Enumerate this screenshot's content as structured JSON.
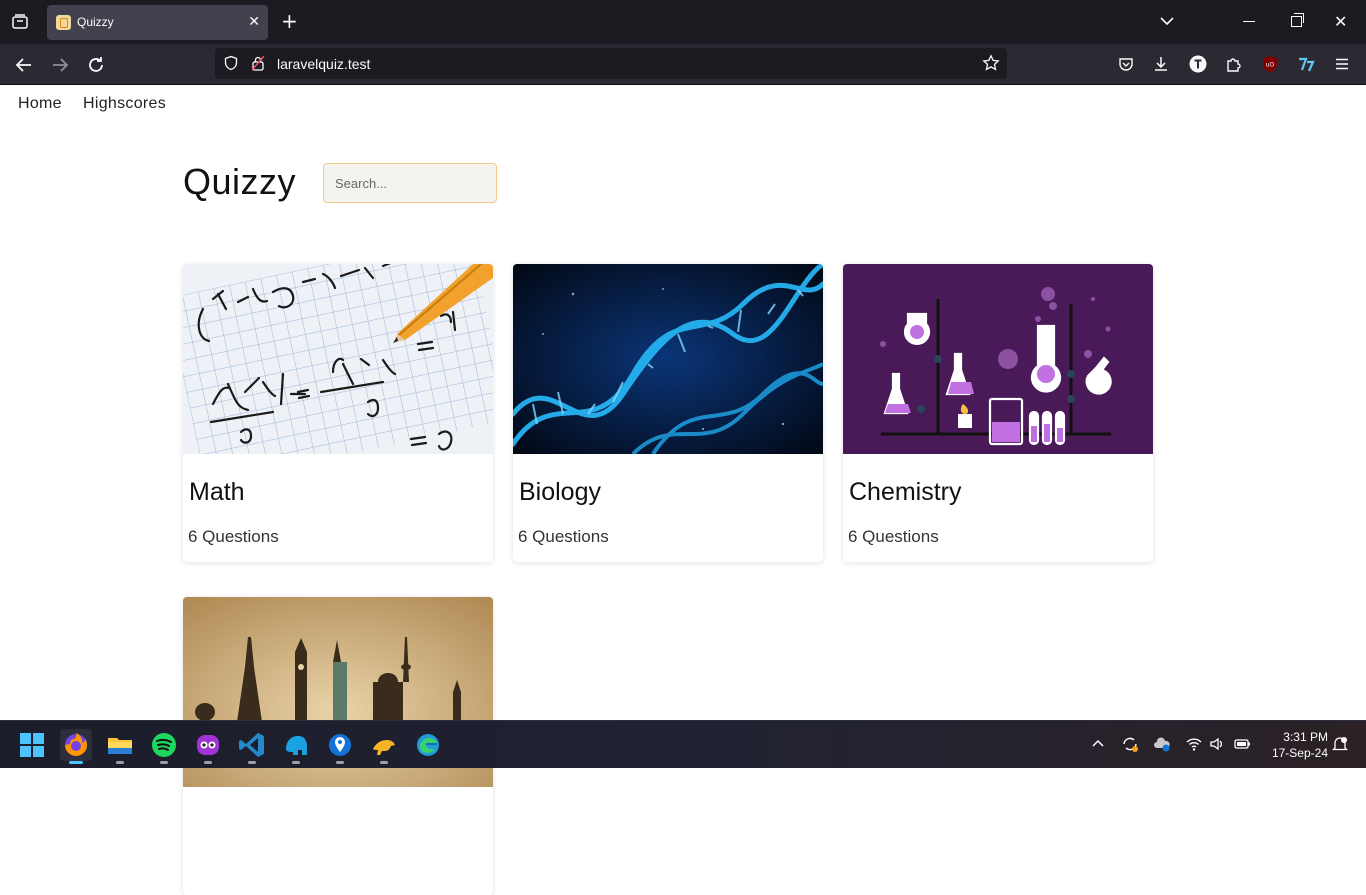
{
  "browser": {
    "tab_title": "Quizzy",
    "url": "laravelquiz.test"
  },
  "site": {
    "nav": [
      {
        "label": "Home"
      },
      {
        "label": "Highscores"
      }
    ],
    "title": "Quizzy",
    "search": {
      "placeholder": "Search...",
      "value": ""
    }
  },
  "quizzes": [
    {
      "title": "Math",
      "questions": "6 Questions",
      "image": "math-notebook-pencil"
    },
    {
      "title": "Biology",
      "questions": "6 Questions",
      "image": "dna-helix"
    },
    {
      "title": "Chemistry",
      "questions": "6 Questions",
      "image": "chemistry-lab-flasks"
    },
    {
      "title": "",
      "questions": "",
      "image": "world-landmarks"
    }
  ],
  "taskbar": {
    "apps": [
      "start",
      "firefox",
      "file-explorer",
      "spotify",
      "copilot",
      "vscode",
      "app-blue",
      "maps",
      "ubuntu-app",
      "edge"
    ],
    "time": "3:31 PM",
    "date": "17-Sep-24"
  },
  "colors": {
    "chrome_bg": "#1c1b22",
    "toolbar_bg": "#2b2a33",
    "search_border": "#f6c98a",
    "chemistry_bg": "#4a1a58",
    "biology_bg": "#041436"
  }
}
